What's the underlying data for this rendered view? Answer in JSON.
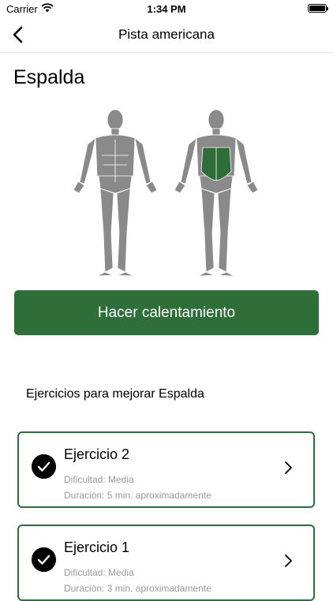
{
  "status_bar": {
    "carrier": "Carrier",
    "time": "1:34 PM"
  },
  "nav": {
    "title": "Pista americana",
    "back_icon": "chevron-left-icon"
  },
  "page": {
    "title": "Espalda"
  },
  "figures": {
    "highlight_color": "#2e6f39",
    "body_color": "#8a8a8a",
    "highlighted_muscle": "back"
  },
  "actions": {
    "warmup_label": "Hacer calentamiento"
  },
  "section": {
    "title": "Ejercicios para mejorar Espalda"
  },
  "exercises": [
    {
      "name": "Ejercicio 2",
      "difficulty": "Dificultad: Media",
      "duration": "Duración: 5 min. aproximadamente",
      "completed": true
    },
    {
      "name": "Ejercicio 1",
      "difficulty": "Dificultad: Media",
      "duration": "Duración: 3 min. aproximadamente",
      "completed": true
    }
  ],
  "colors": {
    "accent": "#2e6f39",
    "meta_text": "#999999"
  }
}
